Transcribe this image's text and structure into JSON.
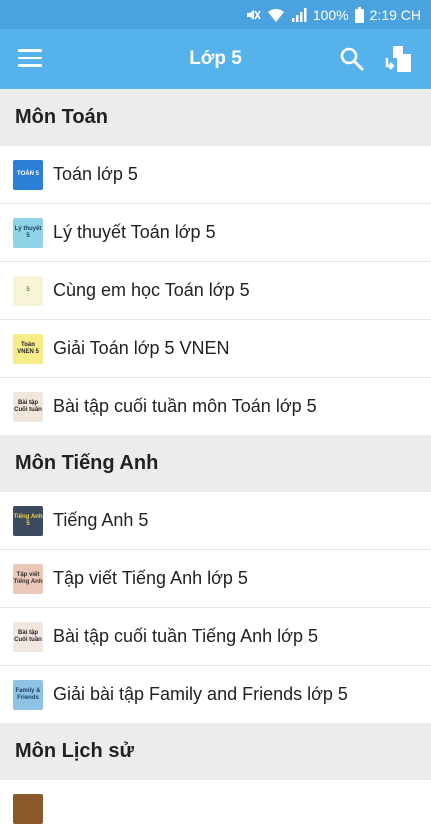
{
  "status_bar": {
    "battery": "100%",
    "time": "2:19 CH"
  },
  "app_bar": {
    "title": "Lớp 5"
  },
  "sections": [
    {
      "title": "Môn Toán",
      "items": [
        {
          "label": "Toán lớp 5",
          "thumb_text": "TOÁN 5",
          "thumb_bg": "#2c7fd6",
          "thumb_fg": "#ffffff"
        },
        {
          "label": "Lý thuyết Toán lớp 5",
          "thumb_text": "Lý thuyết 5",
          "thumb_bg": "#8fd3e8",
          "thumb_fg": "#1a3d5c"
        },
        {
          "label": "Cùng em học Toán lớp 5",
          "thumb_text": "5",
          "thumb_bg": "#f8f4d8",
          "thumb_fg": "#6a8a2a"
        },
        {
          "label": "Giải Toán lớp 5 VNEN",
          "thumb_text": "Toán VNEN 5",
          "thumb_bg": "#f6ec8a",
          "thumb_fg": "#222222"
        },
        {
          "label": "Bài tập cuối tuần môn Toán lớp 5",
          "thumb_text": "Bài tập Cuối tuần",
          "thumb_bg": "#f0e6dc",
          "thumb_fg": "#222222"
        }
      ]
    },
    {
      "title": "Môn Tiếng Anh",
      "items": [
        {
          "label": "Tiếng Anh 5",
          "thumb_text": "Tiếng Anh 5",
          "thumb_bg": "#3b4a5c",
          "thumb_fg": "#f2d34a"
        },
        {
          "label": "Tập viết Tiếng Anh lớp 5",
          "thumb_text": "Tập viết Tiếng Anh",
          "thumb_bg": "#e9c8b8",
          "thumb_fg": "#333333"
        },
        {
          "label": "Bài tập cuối tuần Tiếng Anh lớp 5",
          "thumb_text": "Bài tập Cuối tuần",
          "thumb_bg": "#f2e6e0",
          "thumb_fg": "#222222"
        },
        {
          "label": "Giải bài tập Family and Friends lớp 5",
          "thumb_text": "Family & Friends",
          "thumb_bg": "#8ec3e6",
          "thumb_fg": "#1f3f6a"
        }
      ]
    },
    {
      "title": "Môn Lịch sử",
      "items": [
        {
          "label": "",
          "thumb_text": "",
          "thumb_bg": "#8a5a2a",
          "thumb_fg": "#ffffff"
        }
      ]
    }
  ]
}
